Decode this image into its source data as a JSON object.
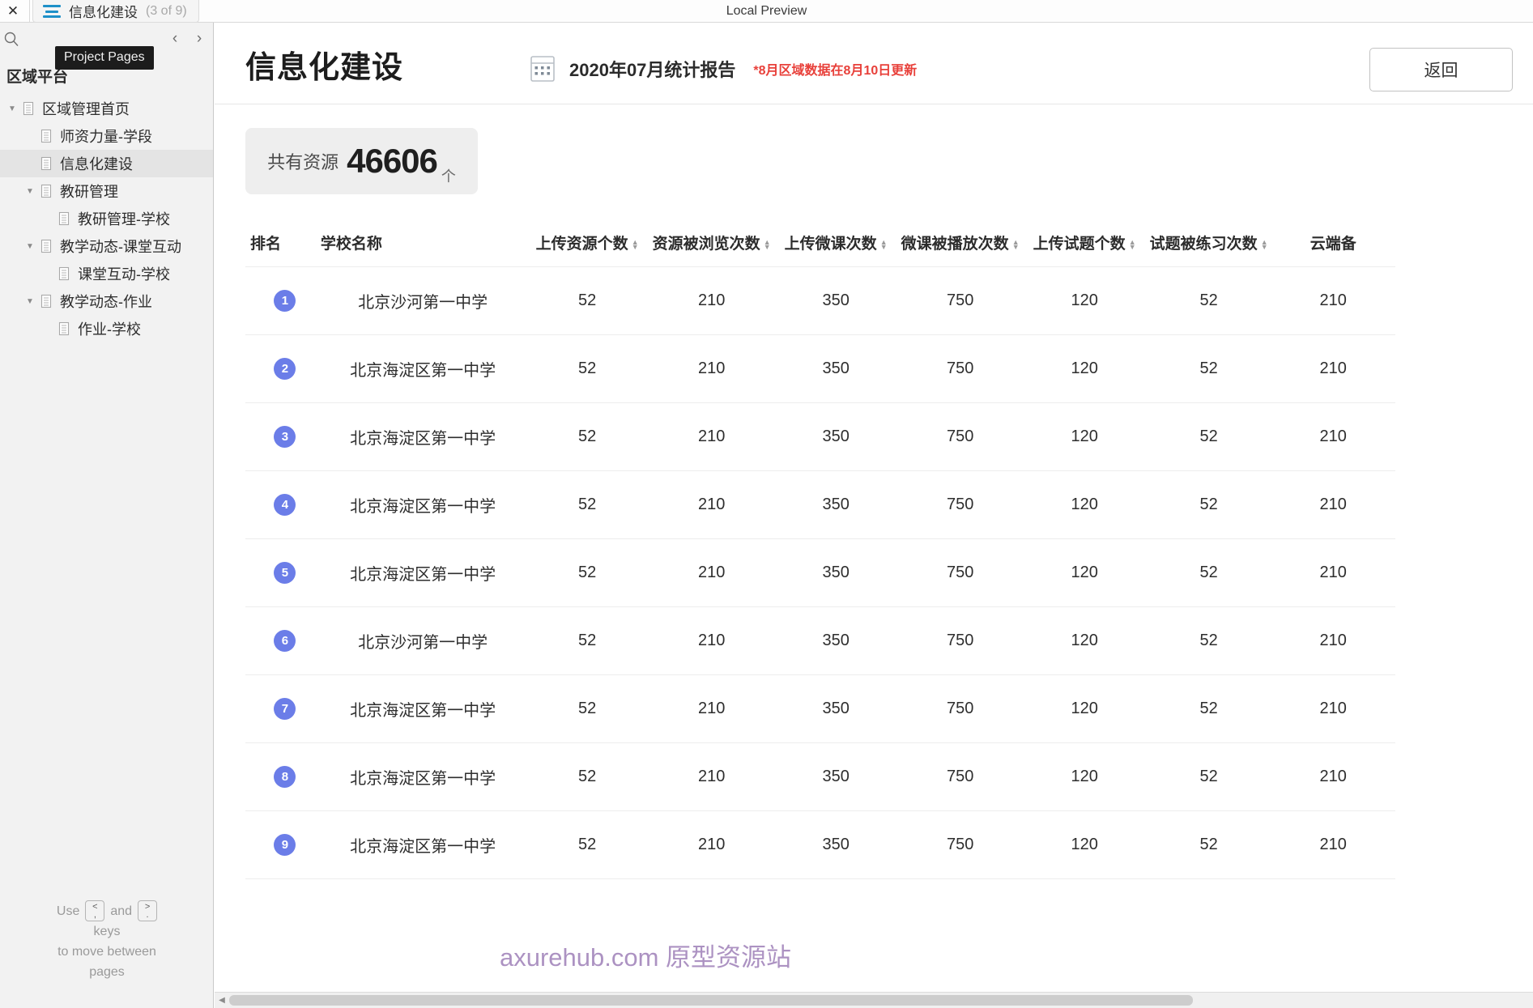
{
  "topbar": {
    "close_label": "✕",
    "tab_title": "信息化建设",
    "tab_count": "(3 of 9)",
    "app_name": "Local Preview"
  },
  "left_panel": {
    "tooltip": "Project Pages",
    "prev_label": "‹",
    "next_label": "›",
    "heading": "区域平台",
    "tree": [
      {
        "label": "区域管理首页",
        "depth": 0,
        "twisty": "▼",
        "selected": false
      },
      {
        "label": "师资力量-学段",
        "depth": 1,
        "twisty": "",
        "selected": false
      },
      {
        "label": "信息化建设",
        "depth": 1,
        "twisty": "",
        "selected": true
      },
      {
        "label": "教研管理",
        "depth": 1,
        "twisty": "▼",
        "selected": false
      },
      {
        "label": "教研管理-学校",
        "depth": 2,
        "twisty": "",
        "selected": false
      },
      {
        "label": "教学动态-课堂互动",
        "depth": 1,
        "twisty": "▼",
        "selected": false
      },
      {
        "label": "课堂互动-学校",
        "depth": 2,
        "twisty": "",
        "selected": false
      },
      {
        "label": "教学动态-作业",
        "depth": 1,
        "twisty": "▼",
        "selected": false
      },
      {
        "label": "作业-学校",
        "depth": 2,
        "twisty": "",
        "selected": false
      }
    ],
    "hint": {
      "use": "Use",
      "key_prev": "<",
      "key_prev_sub": ",",
      "and": "and",
      "key_next": ">",
      "key_next_sub": ".",
      "keys": "keys",
      "line3": "to move between",
      "line4": "pages"
    }
  },
  "main": {
    "title": "信息化建设",
    "report_date": "2020年07月统计报告",
    "report_note": "*8月区域数据在8月10日更新",
    "back_button": "返回",
    "stat_card": {
      "label": "共有资源",
      "value": "46606",
      "unit": "个"
    },
    "watermark": "axurehub.com 原型资源站"
  },
  "table": {
    "columns": [
      {
        "label": "排名",
        "sortable": false,
        "kind": "rank"
      },
      {
        "label": "学校名称",
        "sortable": false,
        "kind": "school"
      },
      {
        "label": "上传资源个数",
        "sortable": true,
        "kind": "num"
      },
      {
        "label": "资源被浏览次数",
        "sortable": true,
        "kind": "num"
      },
      {
        "label": "上传微课次数",
        "sortable": true,
        "kind": "num"
      },
      {
        "label": "微课被播放次数",
        "sortable": true,
        "kind": "num"
      },
      {
        "label": "上传试题个数",
        "sortable": true,
        "kind": "num"
      },
      {
        "label": "试题被练习次数",
        "sortable": true,
        "kind": "num"
      },
      {
        "label": "云端备",
        "sortable": false,
        "kind": "num"
      }
    ],
    "rows": [
      {
        "rank": "1",
        "school": "北京沙河第一中学",
        "values": [
          "52",
          "210",
          "350",
          "750",
          "120",
          "52",
          "210"
        ]
      },
      {
        "rank": "2",
        "school": "北京海淀区第一中学",
        "values": [
          "52",
          "210",
          "350",
          "750",
          "120",
          "52",
          "210"
        ]
      },
      {
        "rank": "3",
        "school": "北京海淀区第一中学",
        "values": [
          "52",
          "210",
          "350",
          "750",
          "120",
          "52",
          "210"
        ]
      },
      {
        "rank": "4",
        "school": "北京海淀区第一中学",
        "values": [
          "52",
          "210",
          "350",
          "750",
          "120",
          "52",
          "210"
        ]
      },
      {
        "rank": "5",
        "school": "北京海淀区第一中学",
        "values": [
          "52",
          "210",
          "350",
          "750",
          "120",
          "52",
          "210"
        ]
      },
      {
        "rank": "6",
        "school": "北京沙河第一中学",
        "values": [
          "52",
          "210",
          "350",
          "750",
          "120",
          "52",
          "210"
        ]
      },
      {
        "rank": "7",
        "school": "北京海淀区第一中学",
        "values": [
          "52",
          "210",
          "350",
          "750",
          "120",
          "52",
          "210"
        ]
      },
      {
        "rank": "8",
        "school": "北京海淀区第一中学",
        "values": [
          "52",
          "210",
          "350",
          "750",
          "120",
          "52",
          "210"
        ]
      },
      {
        "rank": "9",
        "school": "北京海淀区第一中学",
        "values": [
          "52",
          "210",
          "350",
          "750",
          "120",
          "52",
          "210"
        ]
      }
    ]
  },
  "colors": {
    "rank_badge": "#6b7de8",
    "note_red": "#e8403a",
    "watermark_purple": "#9b7bb5",
    "hamburger_blue": "#1e90c8"
  }
}
